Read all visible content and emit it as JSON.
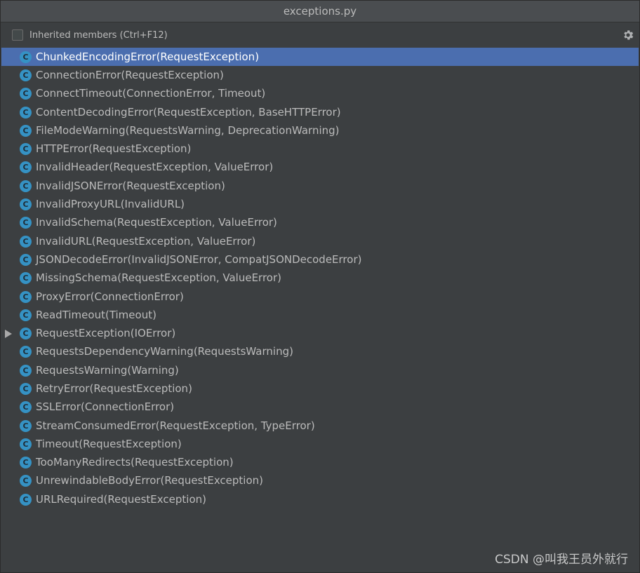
{
  "window": {
    "title": "exceptions.py"
  },
  "toolbar": {
    "inherited_label": "Inherited members (Ctrl+F12)",
    "inherited_checked": false,
    "settings_icon": "gear-icon"
  },
  "members": [
    {
      "label": "ChunkedEncodingError(RequestException)",
      "icon": "class-icon",
      "selected": true
    },
    {
      "label": "ConnectionError(RequestException)",
      "icon": "class-icon"
    },
    {
      "label": "ConnectTimeout(ConnectionError, Timeout)",
      "icon": "class-icon"
    },
    {
      "label": "ContentDecodingError(RequestException, BaseHTTPError)",
      "icon": "class-icon"
    },
    {
      "label": "FileModeWarning(RequestsWarning, DeprecationWarning)",
      "icon": "class-icon"
    },
    {
      "label": "HTTPError(RequestException)",
      "icon": "class-icon"
    },
    {
      "label": "InvalidHeader(RequestException, ValueError)",
      "icon": "class-icon"
    },
    {
      "label": "InvalidJSONError(RequestException)",
      "icon": "class-icon"
    },
    {
      "label": "InvalidProxyURL(InvalidURL)",
      "icon": "class-icon"
    },
    {
      "label": "InvalidSchema(RequestException, ValueError)",
      "icon": "class-icon"
    },
    {
      "label": "InvalidURL(RequestException, ValueError)",
      "icon": "class-icon"
    },
    {
      "label": "JSONDecodeError(InvalidJSONError, CompatJSONDecodeError)",
      "icon": "class-icon"
    },
    {
      "label": "MissingSchema(RequestException, ValueError)",
      "icon": "class-icon"
    },
    {
      "label": "ProxyError(ConnectionError)",
      "icon": "class-icon"
    },
    {
      "label": "ReadTimeout(Timeout)",
      "icon": "class-icon"
    },
    {
      "label": "RequestException(IOError)",
      "icon": "class-icon",
      "expandable": true
    },
    {
      "label": "RequestsDependencyWarning(RequestsWarning)",
      "icon": "class-icon"
    },
    {
      "label": "RequestsWarning(Warning)",
      "icon": "class-icon"
    },
    {
      "label": "RetryError(RequestException)",
      "icon": "class-icon"
    },
    {
      "label": "SSLError(ConnectionError)",
      "icon": "class-icon"
    },
    {
      "label": "StreamConsumedError(RequestException, TypeError)",
      "icon": "class-icon"
    },
    {
      "label": "Timeout(RequestException)",
      "icon": "class-icon"
    },
    {
      "label": "TooManyRedirects(RequestException)",
      "icon": "class-icon"
    },
    {
      "label": "UnrewindableBodyError(RequestException)",
      "icon": "class-icon"
    },
    {
      "label": "URLRequired(RequestException)",
      "icon": "class-icon"
    }
  ],
  "class_icon_letter": "C",
  "watermark": "CSDN @叫我王员外就行",
  "colors": {
    "background": "#3c3f41",
    "selection": "#4b6eaf",
    "class_icon": "#3592c4",
    "text": "#bbbbbb"
  }
}
